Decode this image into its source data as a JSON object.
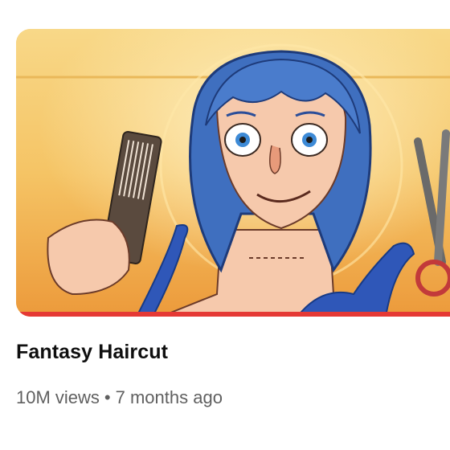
{
  "video": {
    "title": "Fantasy Haircut",
    "views": "10M views",
    "separator": "•",
    "age": "7 months ago",
    "watch_progress": 1.0,
    "progress_color": "#e53935"
  },
  "colors": {
    "thumb_bg_top": "#f7d27e",
    "thumb_bg_bottom": "#eea43f",
    "hair": "#3f6fbf",
    "skin": "#f6c9ac",
    "tentacle": "#2f57b8"
  },
  "icons": [
    "comb-icon",
    "scissors-icon"
  ]
}
